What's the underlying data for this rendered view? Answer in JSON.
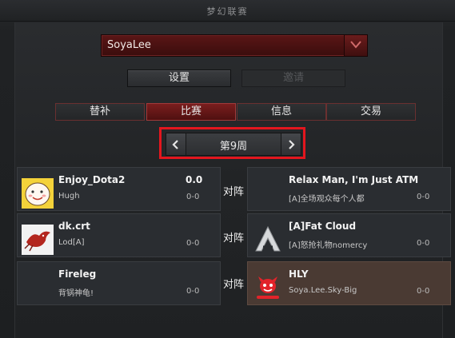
{
  "window": {
    "title": "梦幻联赛"
  },
  "league": {
    "selected": "SoyaLee"
  },
  "actions": {
    "settings": "设置",
    "invite": "邀请"
  },
  "tabs": [
    {
      "label": "替补",
      "active": false
    },
    {
      "label": "比赛",
      "active": true
    },
    {
      "label": "信息",
      "active": false
    },
    {
      "label": "交易",
      "active": false
    }
  ],
  "week": {
    "label": "第9周"
  },
  "vs_label": "对阵",
  "matchups": [
    {
      "home": {
        "name": "Enjoy_Dota2",
        "owner": "Hugh",
        "score": "0.0",
        "record": "0-0",
        "logo": "cartoon-face-logo"
      },
      "away": {
        "name": "Relax Man, I'm Just ATM",
        "owner": "[A]全场观众每个人都",
        "score": "",
        "record": "0-0",
        "logo": ""
      }
    },
    {
      "home": {
        "name": "dk.crt",
        "owner": "Lod[A]",
        "score": "",
        "record": "0-0",
        "logo": "red-bird-logo"
      },
      "away": {
        "name": "[A]Fat Cloud",
        "owner": "[A]怒抢礼物nomercy",
        "score": "",
        "record": "0-0",
        "logo": "alliance-logo"
      }
    },
    {
      "home": {
        "name": "Fireleg",
        "owner": "背锅神龟!",
        "score": "",
        "record": "0-0",
        "logo": ""
      },
      "away": {
        "name": "HLY",
        "owner": "Soya.Lee.Sky-Big",
        "score": "",
        "record": "0-0",
        "logo": "red-mascot-logo",
        "highlight": true
      }
    }
  ]
}
